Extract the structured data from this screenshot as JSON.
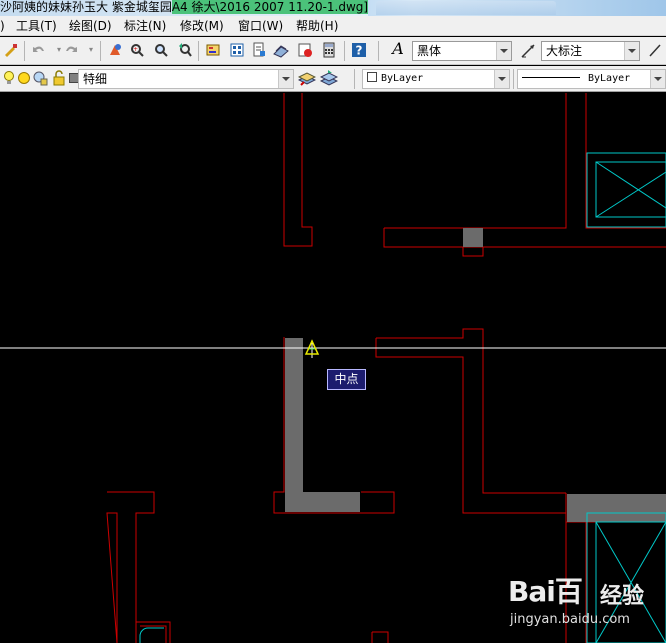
{
  "window": {
    "title_part1": "沙阿姨的妹妹孙玉大 紫金城玺园",
    "title_part2": "A4 徐大\\2016 2007  11.20-1.dwg]"
  },
  "menu": {
    "left_stub": ")",
    "items": [
      "工具(T)",
      "绘图(D)",
      "标注(N)",
      "修改(M)",
      "窗口(W)",
      "帮助(H)"
    ]
  },
  "toolbar1": {
    "text_style_icon": "A",
    "font_value": "黑体",
    "dim_style_value": "大标注"
  },
  "toolbar2": {
    "layer_value": "特细",
    "color_value": "ByLayer",
    "linetype_value": "ByLayer"
  },
  "canvas": {
    "snap_tooltip": "中点",
    "colors": {
      "wall": "#cc0000",
      "fill": "#6b6b6b",
      "window": "#00c8c8",
      "crosshair": "#ffffff",
      "snap_marker": "#e8e800"
    }
  },
  "watermark": {
    "brand": "Bai百",
    "cn": "经验",
    "url": "jingyan.baidu.com"
  },
  "icons": [
    "undo-icon",
    "redo-icon",
    "pan-icon",
    "zoom-icon",
    "help-icon",
    "text-style-icon",
    "dim-style-icon",
    "layer-icon",
    "bulb-icon",
    "sun-icon",
    "lock-icon"
  ]
}
